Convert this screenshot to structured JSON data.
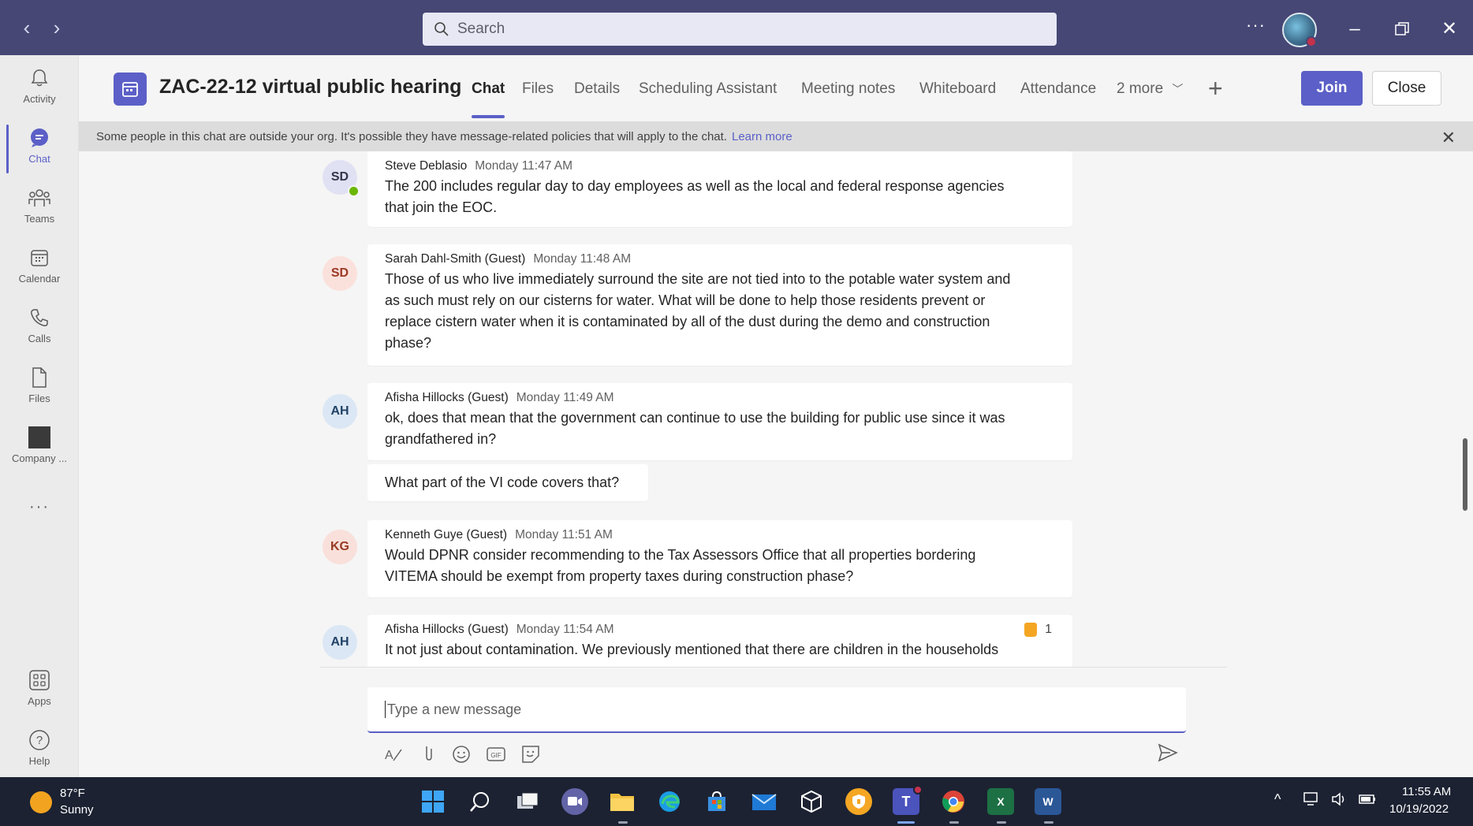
{
  "window": {
    "search_placeholder": "Search",
    "more": "···"
  },
  "rail": [
    {
      "label": "Activity",
      "icon": "bell-icon"
    },
    {
      "label": "Chat",
      "icon": "chat-icon",
      "active": true
    },
    {
      "label": "Teams",
      "icon": "teams-icon"
    },
    {
      "label": "Calendar",
      "icon": "calendar-icon"
    },
    {
      "label": "Calls",
      "icon": "phone-icon"
    },
    {
      "label": "Files",
      "icon": "file-icon"
    },
    {
      "label": "Company ...",
      "icon": "company-icon"
    },
    {
      "label": "Apps",
      "icon": "apps-icon"
    },
    {
      "label": "Help",
      "icon": "help-icon"
    }
  ],
  "header": {
    "title": "ZAC-22-12 virtual public hearing",
    "tabs": [
      "Chat",
      "Files",
      "Details",
      "Scheduling Assistant",
      "Meeting notes",
      "Whiteboard",
      "Attendance",
      "2 more"
    ],
    "join_label": "Join",
    "close_label": "Close"
  },
  "banner": {
    "text": "Some people in this chat are outside your org. It's possible they have message-related policies that will apply to the chat.",
    "link": "Learn more"
  },
  "messages": [
    {
      "initials": "SD",
      "name": "Steve Deblasio",
      "time": "Monday 11:47 AM",
      "lines": [
        "The 200 includes regular day to day employees as well as the local and federal response agencies",
        "that join the EOC."
      ]
    },
    {
      "initials": "SD",
      "name": "Sarah Dahl-Smith (Guest)",
      "time": "Monday 11:48 AM",
      "lines": [
        "Those of us who live immediately surround the site are not tied into to the potable water system and",
        "as such must rely on our cisterns for water. What will be done to help those residents prevent or",
        "replace cistern water when it is contaminated by all of the dust during the demo and construction",
        "phase?"
      ]
    },
    {
      "initials": "AH",
      "name": "Afisha Hillocks (Guest)",
      "time": "Monday 11:49 AM",
      "lines": [
        "ok, does that mean that the government can continue to use the building for public use since it was",
        "grandfathered in?"
      ]
    },
    {
      "followup": "What part of the VI code covers that?"
    },
    {
      "initials": "KG",
      "name": "Kenneth Guye (Guest)",
      "time": "Monday 11:51 AM",
      "lines": [
        "Would DPNR consider recommending to the Tax Assessors Office that all properties bordering",
        "VITEMA should be exempt from property taxes during construction phase?"
      ]
    },
    {
      "initials": "AH",
      "name": "Afisha Hillocks (Guest)",
      "time": "Monday 11:54 AM",
      "reaction": "1",
      "lines": [
        "It not just about contamination. We previously mentioned that there are children in the households"
      ]
    }
  ],
  "compose": {
    "placeholder": "Type a new message"
  },
  "taskbar": {
    "temp": "87°F",
    "weather": "Sunny",
    "time": "11:55 AM",
    "date": "10/19/2022"
  }
}
